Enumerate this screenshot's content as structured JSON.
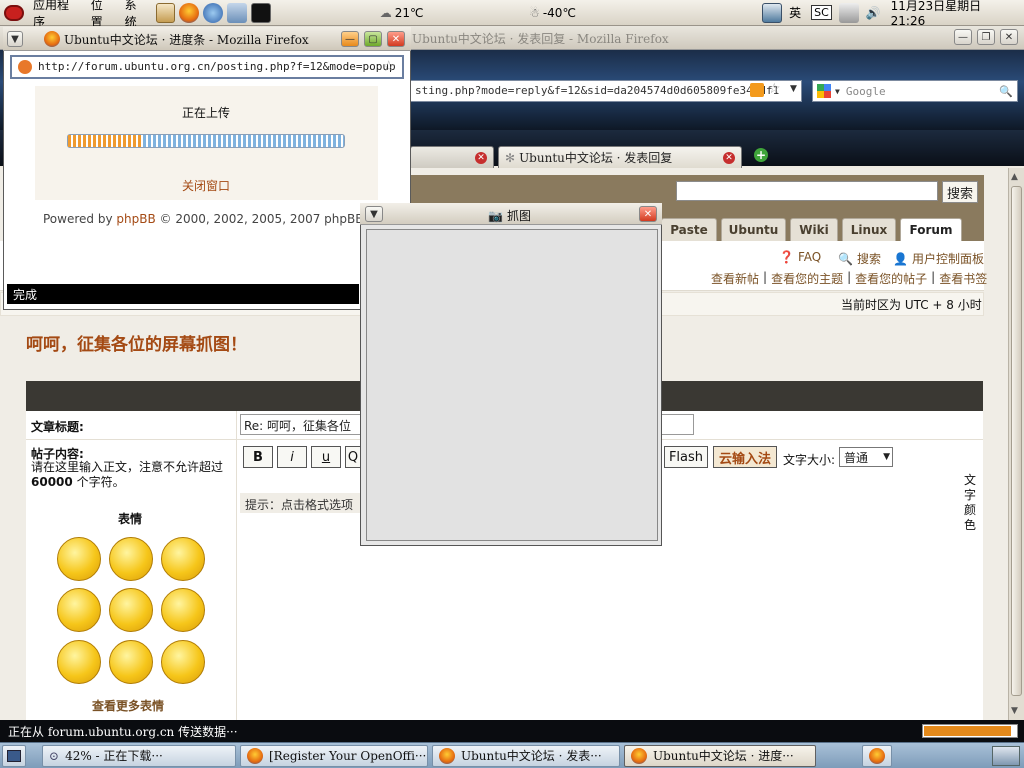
{
  "top_panel": {
    "menu_apps": "应用程序",
    "menu_places": "位置",
    "menu_system": "系统",
    "weather1": "21℃",
    "weather2": "-40℃",
    "ime_label": "英",
    "sc_label": "SC",
    "clock": "11月23日星期日 21:26"
  },
  "main_window": {
    "title": "Ubuntu中文论坛 · 发表回复 - Mozilla Firefox",
    "url": "sting.php?mode=reply&f=12&sid=da204574d0d605809fe340df1",
    "search_engine": "Google",
    "tab1_label": "",
    "tab2_label": "Ubuntu中文论坛 · 发表回复"
  },
  "forum": {
    "search_button": "搜索",
    "nav_tabs": [
      "Paste",
      "Ubuntu",
      "Wiki",
      "Linux",
      "Forum"
    ],
    "faq": "FAQ",
    "search_link": "搜索",
    "ucp": "用户控制面板",
    "links": [
      "查看新帖",
      "查看您的主题",
      "查看您的帖子",
      "查看书签"
    ],
    "timezone": "当前时区为 UTC + 8 小时",
    "topic_title": "呵呵，征集各位的屏幕抓图！",
    "subject_label": "文章标题:",
    "subject_value": "Re: 呵呵，征集各位",
    "body_label": "帖子内容:",
    "body_hint_line1": "请在这里输入正文，注意不允许超过",
    "body_hint_count": "60000",
    "body_hint_line2": " 个字符。",
    "smilies_label": "表情",
    "more_smilies": "查看更多表情",
    "fmt_b": "B",
    "fmt_i": "i",
    "fmt_u": "u",
    "fmt_q": "Q",
    "fmt_flash": "Flash",
    "cloud_ime": "云输入法",
    "font_size_label": "文字大小:",
    "font_size_value": "普通",
    "hint_text": "提示：点击格式选项",
    "text_color": "文字颜色"
  },
  "popup": {
    "title": "Ubuntu中文论坛 · 进度条 - Mozilla Firefox",
    "url": "http://forum.ubuntu.org.cn/posting.php?f=12&mode=popup",
    "uploading": "正在上传",
    "progress_fraction": 0.27,
    "close_window": "关闭窗口",
    "powered_prefix": "Powered by ",
    "powered_link": "phpBB",
    "powered_suffix": " © 2000, 2002, 2005, 2007 phpBB Grou",
    "status": "完成"
  },
  "dialog": {
    "title": "抓图"
  },
  "status_bar": {
    "text": "正在从 forum.ubuntu.org.cn 传送数据···",
    "progress_fraction": 0.95
  },
  "taskbar": {
    "items": [
      "42% - 正在下载···",
      "[Register Your OpenOffi···",
      "Ubuntu中文论坛 · 发表···",
      "Ubuntu中文论坛 · 进度···"
    ]
  },
  "colors": {
    "accent_link": "#7a5226",
    "topic_title": "#a44a14",
    "close_red": "#c62e2e"
  }
}
